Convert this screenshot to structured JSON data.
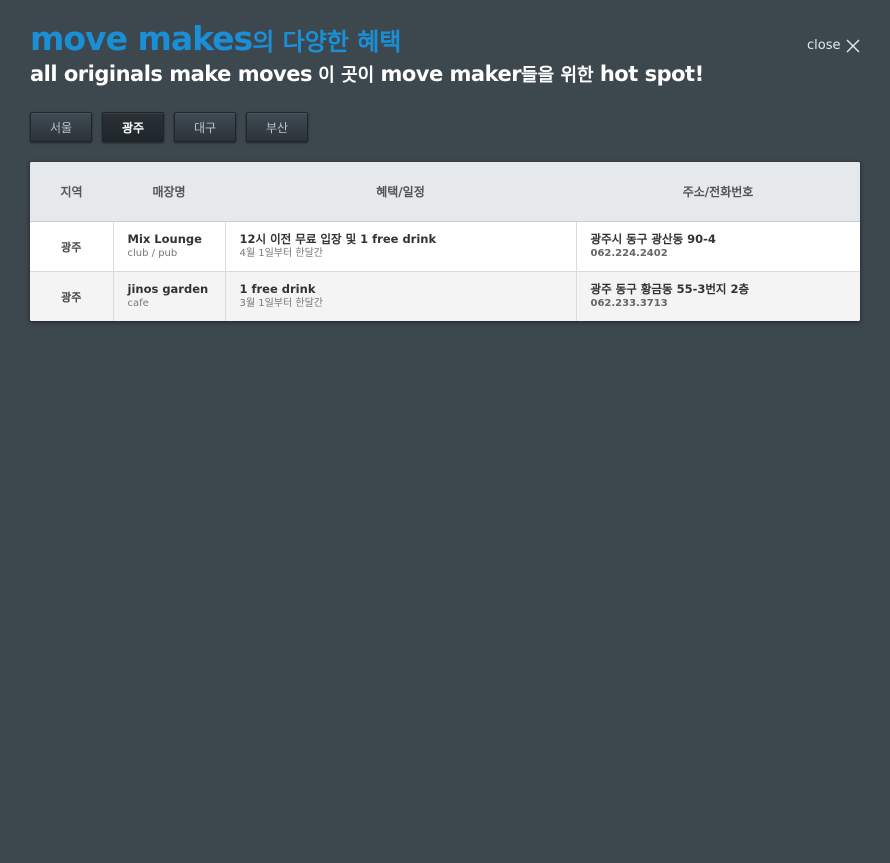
{
  "header": {
    "brand": "move makes",
    "title_suffix": "의 다양한 혜택",
    "subtitle_en1": "all originals make moves",
    "subtitle_kr1": " 이 곳이 ",
    "subtitle_en2": "move maker",
    "subtitle_kr2": "들을 위한 ",
    "subtitle_en3": "hot spot!",
    "brand_color": "#1a8fd6",
    "title_color": "#ffffff"
  },
  "close": {
    "label": "close",
    "icon": "close-icon"
  },
  "tabs": [
    {
      "label": "서울",
      "active": false
    },
    {
      "label": "광주",
      "active": true
    },
    {
      "label": "대구",
      "active": false
    },
    {
      "label": "부산",
      "active": false
    }
  ],
  "table": {
    "headers": [
      "지역",
      "매장명",
      "혜택/일정",
      "주소/전화번호"
    ],
    "rows": [
      {
        "region": "광주",
        "store_name": "Mix Lounge",
        "store_type": "club / pub",
        "benefit": "12시 이전 무료 입장 및 1 free drink",
        "schedule": "4월 1일부터 한달간",
        "address": "광주시 동구 광산동 90-4",
        "phone": "062.224.2402"
      },
      {
        "region": "광주",
        "store_name": "jinos garden",
        "store_type": "cafe",
        "benefit": "1 free drink",
        "schedule": "3월 1일부터 한달간",
        "address": "광주 동구 황금동 55-3번지 2층",
        "phone": "062.233.3713"
      }
    ]
  },
  "colors": {
    "background": "#3d474e",
    "header_row": "#e6e9eb"
  }
}
